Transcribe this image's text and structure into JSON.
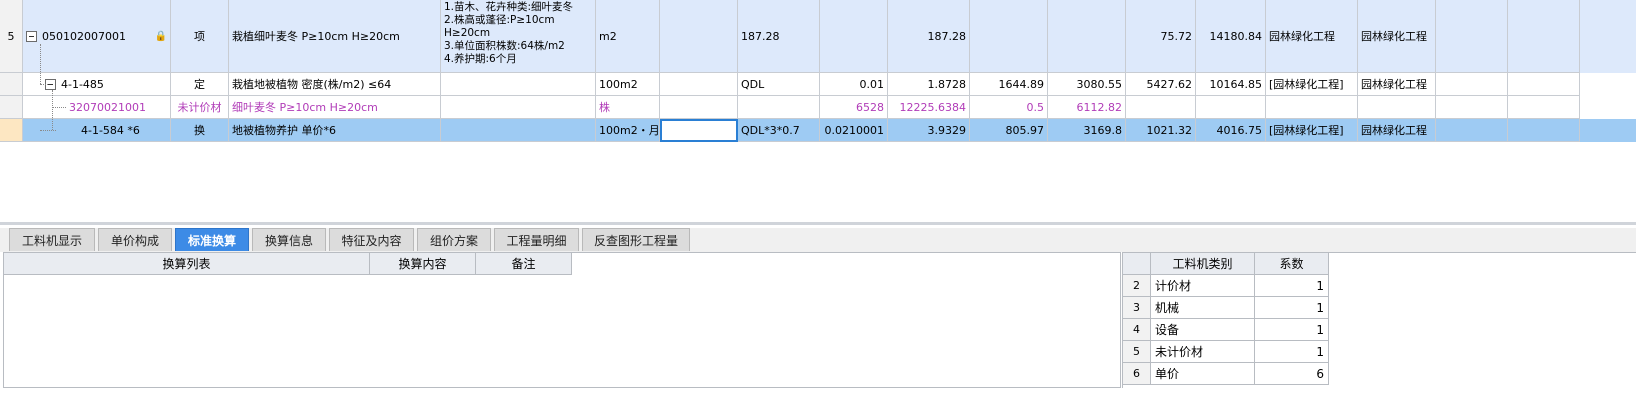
{
  "grid": {
    "row_xiang": {
      "rownum": "5",
      "code": "050102007001",
      "type": "项",
      "name": "栽植细叶麦冬 P≥10cm H≥20cm",
      "features": [
        "1.苗木、花卉种类:细叶麦冬",
        "2.株高或蓬径:P≥10cm",
        "H≥20cm",
        "3.单位面积株数:64株/m2",
        "4.养护期:6个月"
      ],
      "unit": "m2",
      "qty1": "187.28",
      "qty2": "187.28",
      "unit_price": "75.72",
      "total": "14180.84",
      "specialty": "园林绿化工程",
      "category": "园林绿化工程"
    },
    "row_ding": {
      "code": "4-1-485",
      "type": "定",
      "name": "栽植地被植物 密度(株/m2) ≤64",
      "unit": "100m2",
      "expr": "QDL",
      "content": "0.01",
      "qty": "1.8728",
      "v1": "1644.89",
      "v2": "3080.55",
      "v3": "5427.62",
      "v4": "10164.85",
      "specialty": "[园林绿化工程]",
      "category": "园林绿化工程"
    },
    "row_zc": {
      "code": "32070021001",
      "type": "未计价材",
      "name": "细叶麦冬 P≥10cm H≥20cm",
      "unit": "株",
      "content": "6528",
      "qty": "12225.6384",
      "v1": "0.5",
      "v2": "6112.82"
    },
    "row_huan": {
      "code": "4-1-584 *6",
      "type": "换",
      "name": "地被植物养护 单价*6",
      "unit": "100m2・月",
      "expr": "QDL*3*0.7",
      "content": "0.0210001",
      "qty": "3.9329",
      "v1": "805.97",
      "v2": "3169.8",
      "v3": "1021.32",
      "v4": "4016.75",
      "specialty": "[园林绿化工程]",
      "category": "园林绿化工程"
    }
  },
  "tabs": [
    "工料机显示",
    "单价构成",
    "标准换算",
    "换算信息",
    "特征及内容",
    "组价方案",
    "工程量明细",
    "反查图形工程量"
  ],
  "active_tab": "标准换算",
  "left_panel": {
    "headers": [
      "换算列表",
      "换算内容",
      "备注"
    ]
  },
  "right_panel": {
    "headers": [
      "工料机类别",
      "系数"
    ],
    "rows": [
      {
        "n": "2",
        "k": "计价材",
        "v": "1"
      },
      {
        "n": "3",
        "k": "机械",
        "v": "1"
      },
      {
        "n": "4",
        "k": "设备",
        "v": "1"
      },
      {
        "n": "5",
        "k": "未计价材",
        "v": "1"
      },
      {
        "n": "6",
        "k": "单价",
        "v": "6"
      }
    ]
  },
  "colors": {
    "row_item_bg": "#dde9fb",
    "row_selected_bg": "#9ecbf3",
    "material_text": "#b13cb8",
    "active_tab_bg": "#3d8be6"
  },
  "icons": [
    "collapse-icon",
    "lock-icon"
  ]
}
